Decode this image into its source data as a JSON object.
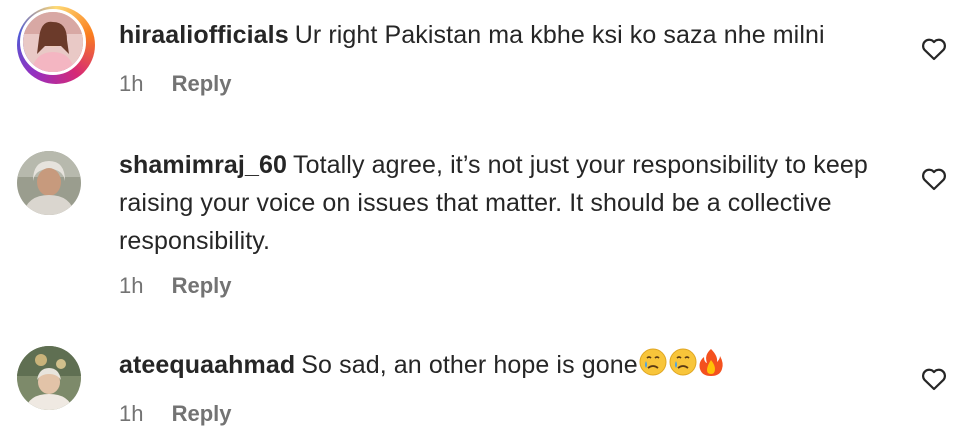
{
  "comments": [
    {
      "username": "hiraaliofficials",
      "text": "Ur right Pakistan ma kbhe ksi ko saza nhe milni",
      "time": "1h",
      "reply_label": "Reply",
      "has_story_ring": true
    },
    {
      "username": "shamimraj_60",
      "text": "Totally agree, it’s not just your responsibility to keep raising your voice on issues that matter. It should be a collective responsibility.",
      "time": "1h",
      "reply_label": "Reply",
      "has_story_ring": false
    },
    {
      "username": "ateequaahmad",
      "text": "So sad, an other hope is gone",
      "emojis": [
        "crying-face",
        "crying-face",
        "fire"
      ],
      "time": "1h",
      "reply_label": "Reply",
      "has_story_ring": false
    }
  ],
  "icons": {
    "like": "heart-outline-icon"
  },
  "colors": {
    "text": "#262626",
    "meta": "#737373"
  }
}
